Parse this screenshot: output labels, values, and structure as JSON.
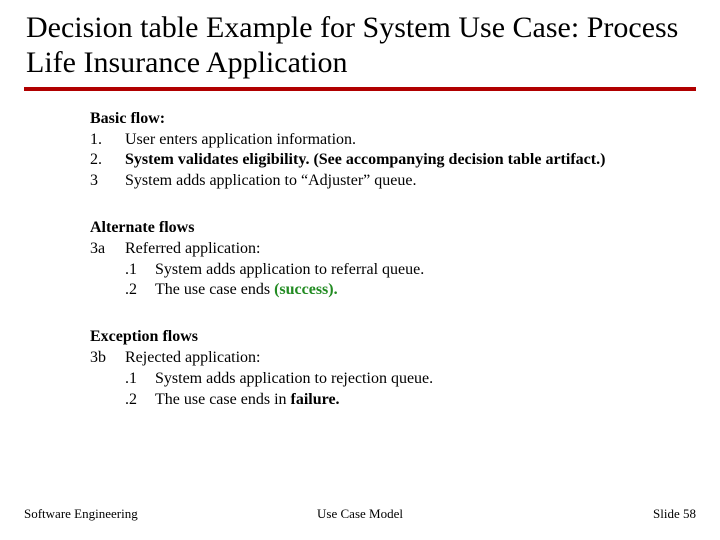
{
  "title": "Decision table Example for System Use Case: Process Life Insurance Application",
  "basic": {
    "heading": "Basic flow:",
    "items": [
      {
        "num": "1.",
        "text": "User enters application information."
      },
      {
        "num": "2.",
        "text": "System validates eligibility. (See accompanying decision table artifact.)",
        "bold": true
      },
      {
        "num": "3",
        "text": "System adds application to “Adjuster” queue."
      }
    ]
  },
  "alternate": {
    "heading": "Alternate flows",
    "lead": {
      "num": "3a",
      "text": "Referred application:"
    },
    "subitems": [
      {
        "num": ".1",
        "text": "System adds application to referral queue."
      },
      {
        "num": ".2",
        "prefix": "The use case ends ",
        "suffix": "(success).",
        "success": true
      }
    ]
  },
  "exception": {
    "heading": "Exception flows",
    "lead": {
      "num": "3b",
      "text": "Rejected application:"
    },
    "subitems": [
      {
        "num": ".1",
        "text": "System adds application to rejection queue."
      },
      {
        "num": ".2",
        "prefix": "The use case ends in ",
        "suffix": "failure.",
        "boldsuffix": true
      }
    ]
  },
  "footer": {
    "left": "Software Engineering",
    "center": "Use Case Model",
    "right": "Slide  58"
  }
}
